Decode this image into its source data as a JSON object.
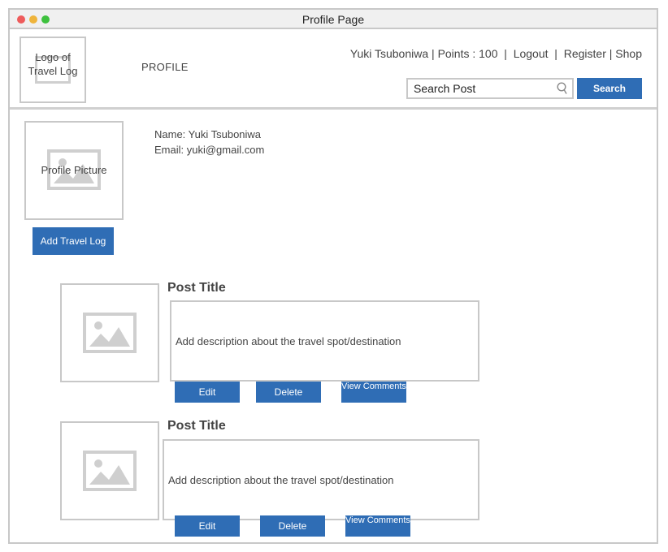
{
  "window": {
    "title": "Profile Page"
  },
  "header": {
    "logo_text": "Logo of Travel Log",
    "nav_label": "PROFILE",
    "user_name": "Yuki Tsuboniwa",
    "points": "Points : 100",
    "links": [
      "Logout",
      "Register",
      "Shop"
    ],
    "search_placeholder": "Search Post",
    "search_button": "Search"
  },
  "profile": {
    "picture_label": "Profile Picture",
    "name": "Name: Yuki Tsuboniwa",
    "email": "Email: yuki@gmail.com",
    "add_button": "Add Travel Log"
  },
  "posts": [
    {
      "title": "Post Title",
      "description": "Add description about the travel spot/destination",
      "edit": "Edit",
      "delete": "Delete",
      "view_comments": "View Comments"
    },
    {
      "title": "Post Title",
      "description": "Add description about the travel spot/destination",
      "edit": "Edit",
      "delete": "Delete",
      "view_comments": "View Comments"
    }
  ],
  "colors": {
    "accent": "#2f6db5",
    "border": "#c8c8c8"
  }
}
